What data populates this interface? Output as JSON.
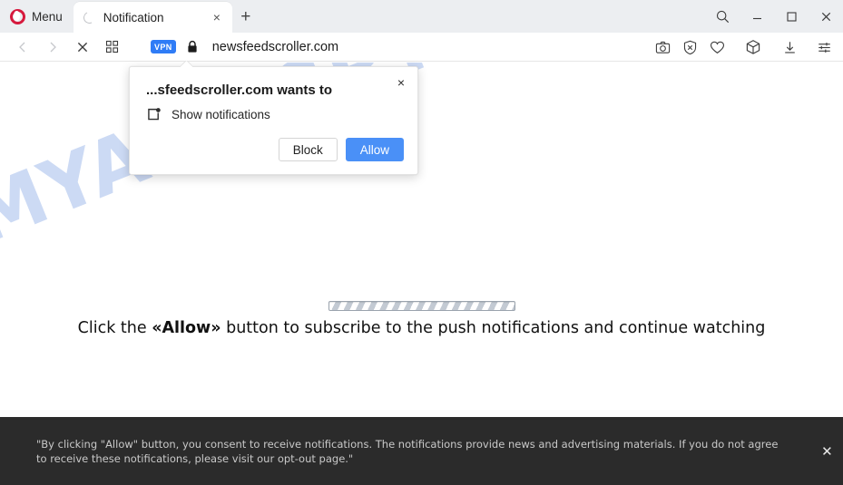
{
  "browser": {
    "menu_label": "Menu",
    "tab": {
      "title": "Notification",
      "close_label": "×",
      "spinner": "loading-spinner"
    },
    "new_tab_label": "+",
    "window_controls": {
      "search": "search-icon",
      "minimize": "–",
      "maximize": "□",
      "close": "×"
    }
  },
  "address_bar": {
    "url": "newsfeedscroller.com",
    "vpn_badge": "VPN",
    "back": "back-arrow-icon",
    "forward": "forward-arrow-icon",
    "stop": "stop-icon",
    "speeddial": "speed-dial-icon",
    "lock": "padlock-icon",
    "right_icons": [
      "camera-snapshot-icon",
      "ad-blocker-shield-icon",
      "heart-favorite-icon",
      "extensions-cube-icon",
      "downloads-icon",
      "easy-setup-sliders-icon"
    ]
  },
  "dialog": {
    "title": "...sfeedscroller.com wants to",
    "permission_icon": "show-notifications-icon",
    "permission_label": "Show notifications",
    "close_label": "×",
    "block_label": "Block",
    "allow_label": "Allow",
    "allow_color": "#4a90f7"
  },
  "page": {
    "watermark": "MYANTISPYWARE.COM",
    "watermark_color": "#ccdaf4",
    "progress_bar": "striped-progress-bar",
    "instruction_pre": "Click the ",
    "instruction_emphasis": "«Allow»",
    "instruction_post": " button to subscribe to the push notifications and continue watching"
  },
  "consent_bar": {
    "text": "\"By clicking \"Allow\" button, you consent to receive notifications. The notifications provide news and advertising materials. If you do not agree to receive these notifications, please visit our opt-out page.\"",
    "close_label": "✕",
    "background": "#2b2b2b"
  }
}
